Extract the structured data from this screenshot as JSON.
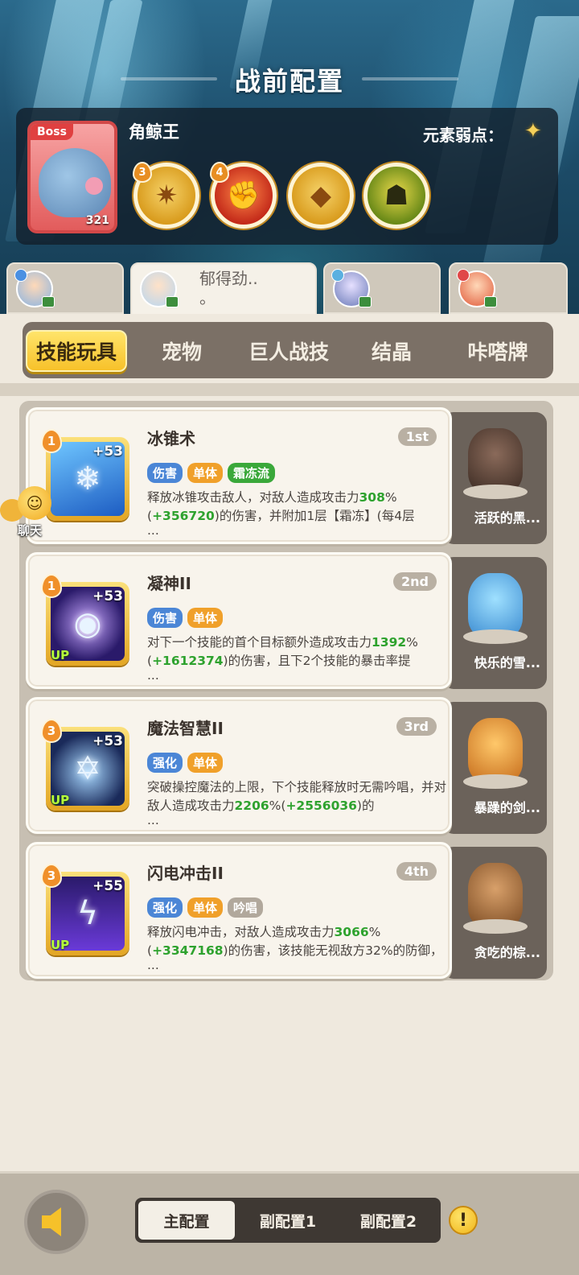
{
  "header": {
    "title": "战前配置"
  },
  "boss": {
    "tag": "Boss",
    "level": "321",
    "name": "角鲸王",
    "weakness_label": "元素弱点：",
    "weakness_icon": "yellow-star-icon",
    "skills": [
      {
        "level": "3",
        "icon": "spiky-star-icon"
      },
      {
        "level": "4",
        "icon": "fist-icon"
      },
      {
        "level": "",
        "icon": "cube-icon"
      },
      {
        "level": "",
        "icon": "shadow-creature-icon"
      }
    ]
  },
  "hero_tabs": [
    {
      "name": "",
      "active": false
    },
    {
      "name": "郁得劲..\n。",
      "active": true
    },
    {
      "name": "",
      "active": false
    },
    {
      "name": "",
      "active": false
    }
  ],
  "category_tabs": [
    "技能玩具",
    "宠物",
    "巨人战技",
    "结晶",
    "咔嗒牌"
  ],
  "active_category": "技能玩具",
  "skills": [
    {
      "name": "冰锥术",
      "rank": "1st",
      "level": "1",
      "plus": "+53",
      "up": "",
      "tags": [
        {
          "text": "伤害",
          "kind": "dmg"
        },
        {
          "text": "单体",
          "kind": "single"
        },
        {
          "text": "霜冻流",
          "kind": "frost"
        }
      ],
      "desc_parts": [
        "释放冰锥攻击敌人，对敌人造成攻击力",
        "308",
        "%(",
        "+356720",
        ")的伤害，并附加1层【霜冻】(每4层"
      ],
      "more": "...",
      "pet_name": "活跃的黑..."
    },
    {
      "name": "凝神II",
      "rank": "2nd",
      "level": "1",
      "plus": "+53",
      "up": "UP",
      "tags": [
        {
          "text": "伤害",
          "kind": "dmg"
        },
        {
          "text": "单体",
          "kind": "single"
        }
      ],
      "desc_parts": [
        "对下一个技能的首个目标额外造成攻击力",
        "1392",
        "%(",
        "+1612374",
        ")的伤害，且下2个技能的暴击率提"
      ],
      "more": "...",
      "pet_name": "快乐的雪..."
    },
    {
      "name": "魔法智慧II",
      "rank": "3rd",
      "level": "3",
      "plus": "+53",
      "up": "UP",
      "tags": [
        {
          "text": "强化",
          "kind": "buff"
        },
        {
          "text": "单体",
          "kind": "single"
        }
      ],
      "desc_parts": [
        "突破操控魔法的上限，下个技能释放时无需吟唱，并对敌人造成攻击力",
        "2206",
        "%(",
        "+2556036",
        ")的"
      ],
      "more": "...",
      "pet_name": "暴躁的剑..."
    },
    {
      "name": "闪电冲击II",
      "rank": "4th",
      "level": "3",
      "plus": "+55",
      "up": "UP",
      "tags": [
        {
          "text": "强化",
          "kind": "buff"
        },
        {
          "text": "单体",
          "kind": "single"
        },
        {
          "text": "吟唱",
          "kind": "chant"
        }
      ],
      "desc_parts": [
        "释放闪电冲击，对敌人造成攻击力",
        "3066",
        "%(",
        "+3347168",
        ")的伤害，该技能无视敌方32%的防御，"
      ],
      "more": "...",
      "pet_name": "贪吃的棕..."
    }
  ],
  "chat": {
    "label": "聊天",
    "icon": "smiley-bubble-icon"
  },
  "bottom": {
    "configs": [
      "主配置",
      "副配置1",
      "副配置2"
    ],
    "active_config": "主配置",
    "warn": "!"
  },
  "colors": {
    "accent_yellow": "#f7c12a",
    "green_value": "#2ea22e",
    "tag_blue": "#4b86d6",
    "tag_orange": "#f0a02a",
    "tag_green": "#3aa83a"
  }
}
